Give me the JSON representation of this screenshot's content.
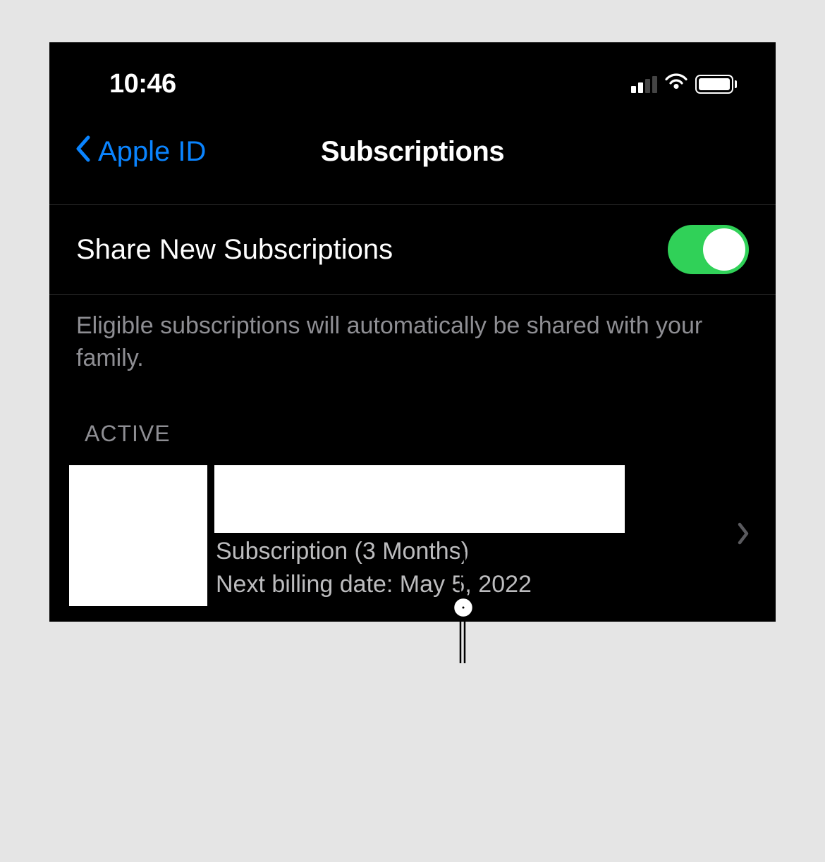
{
  "statusBar": {
    "time": "10:46"
  },
  "nav": {
    "backLabel": "Apple ID",
    "title": "Subscriptions"
  },
  "shareRow": {
    "label": "Share New Subscriptions",
    "enabled": true
  },
  "shareFooter": "Eligible subscriptions will automatically be shared with your family.",
  "sections": {
    "activeHeader": "ACTIVE"
  },
  "subscription": {
    "plan": "Subscription (3 Months)",
    "billing": "Next billing date: May 5, 2022"
  }
}
